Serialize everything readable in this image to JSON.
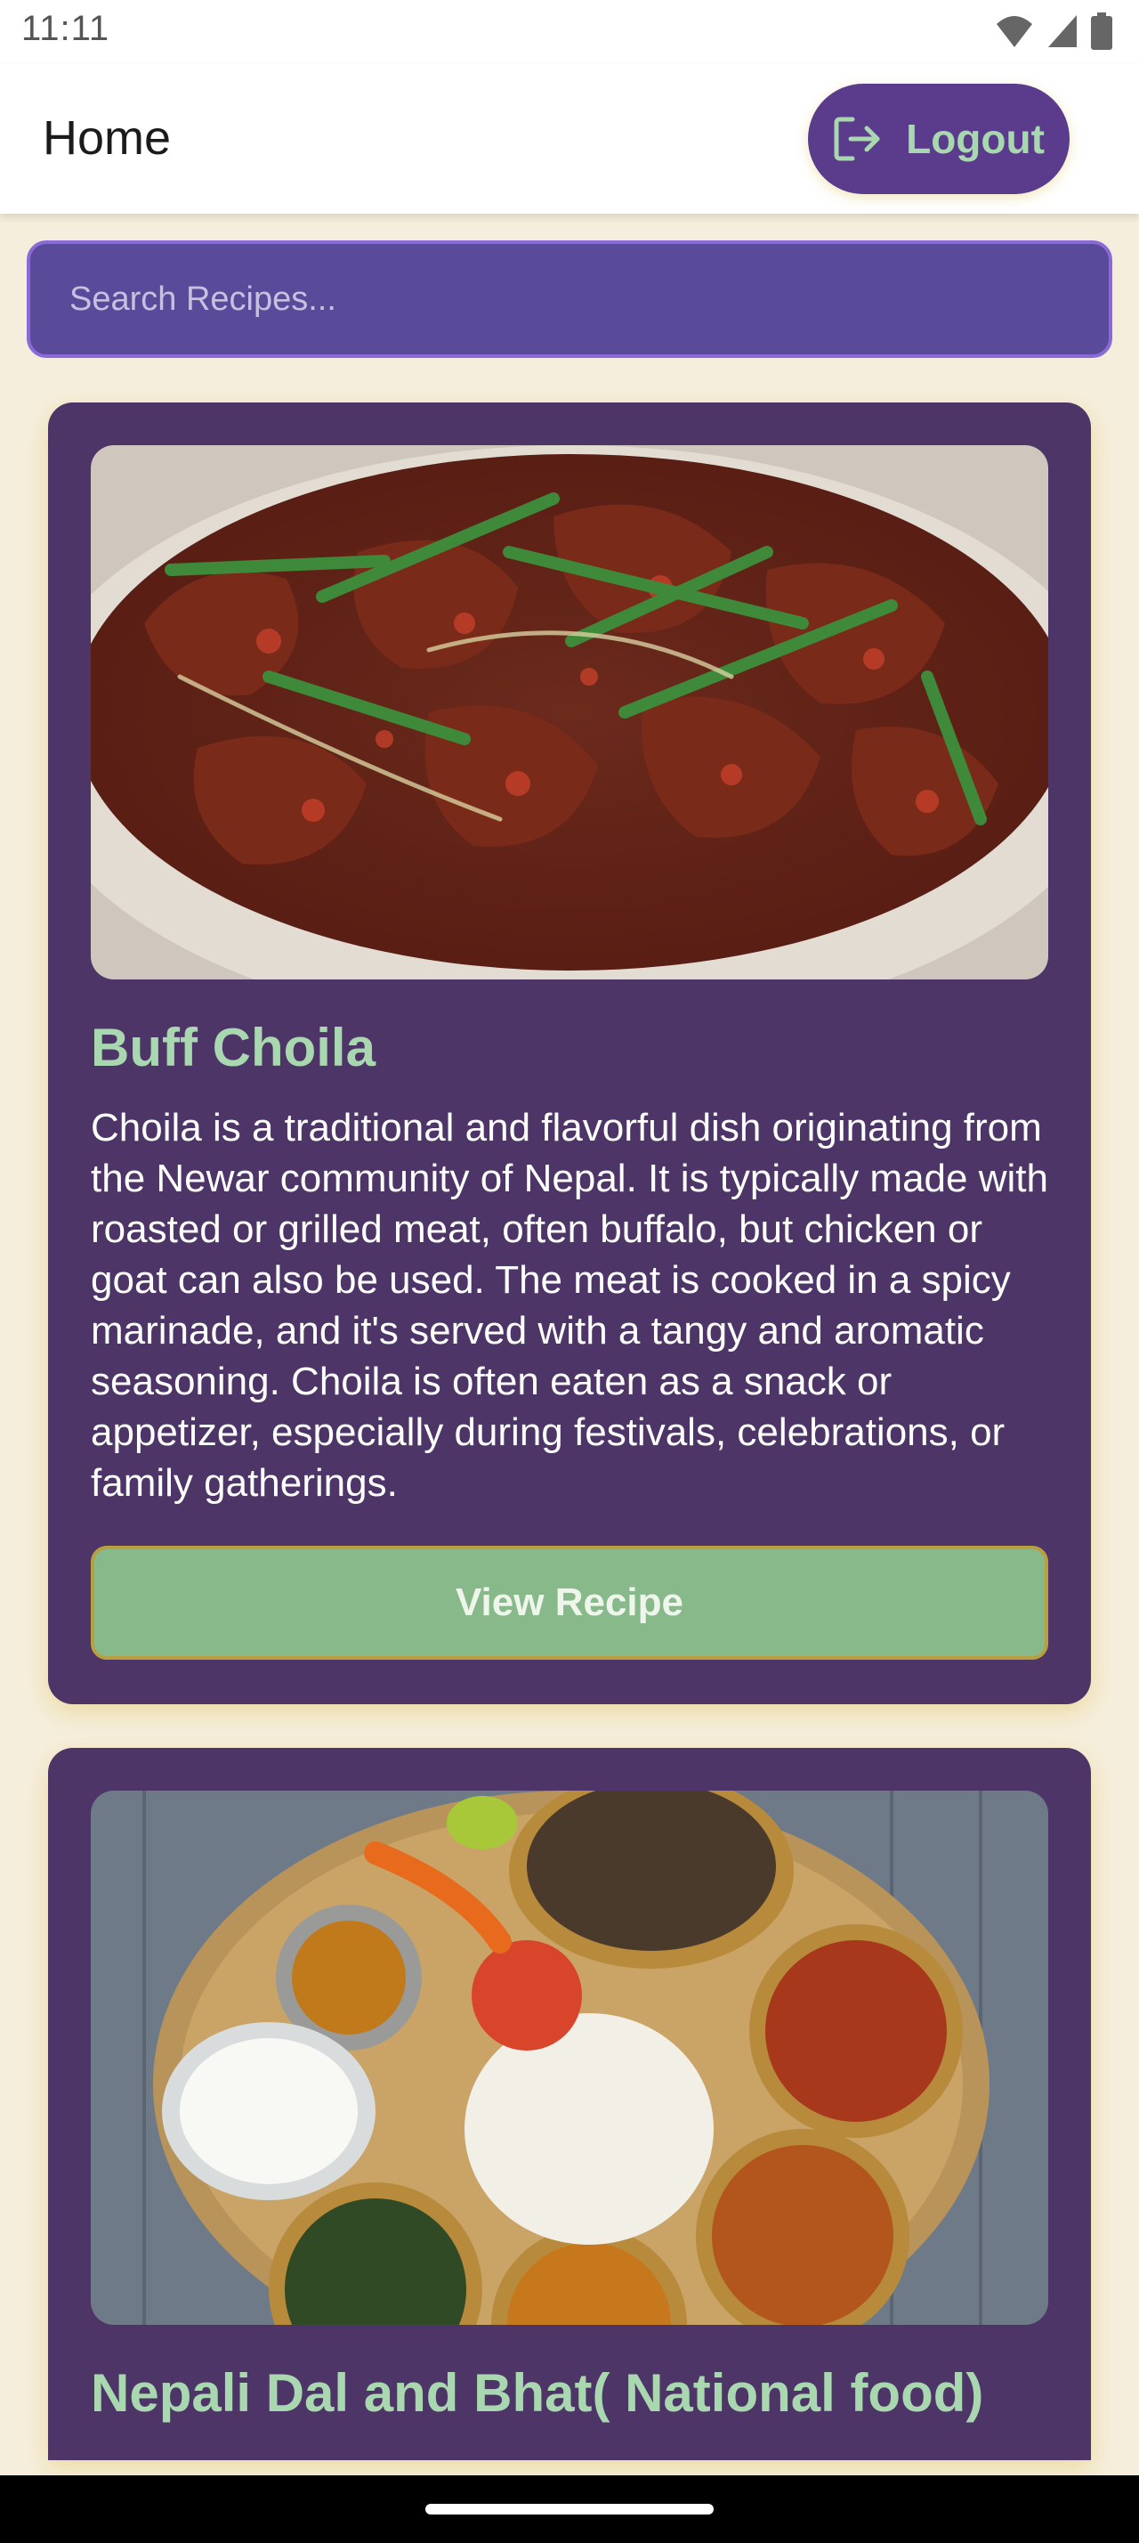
{
  "status_bar": {
    "time": "11:11",
    "icons": [
      "wifi-icon",
      "cell-signal-icon",
      "battery-icon"
    ]
  },
  "app_bar": {
    "title": "Home",
    "logout_label": "Logout",
    "logout_icon": "logout-icon"
  },
  "search": {
    "placeholder": "Search Recipes...",
    "value": ""
  },
  "recipes": [
    {
      "title": "Buff Choila",
      "description": "Choila is a traditional and flavorful dish originating from the Newar community of Nepal. It is typically made with roasted or grilled meat, often buffalo, but chicken or goat can also be used. The meat is cooked in a spicy marinade, and it's served with a tangy and aromatic seasoning. Choila is often eaten as a snack or appetizer, especially during festivals, celebrations, or family gatherings.",
      "button_label": "View Recipe"
    },
    {
      "title": "Nepali Dal and Bhat( National food)"
    }
  ],
  "colors": {
    "background": "#f6eedc",
    "primary": "#5b3c8c",
    "card": "#4e3567",
    "accent_green": "#a9d8b0",
    "button_green": "#88b98a"
  }
}
